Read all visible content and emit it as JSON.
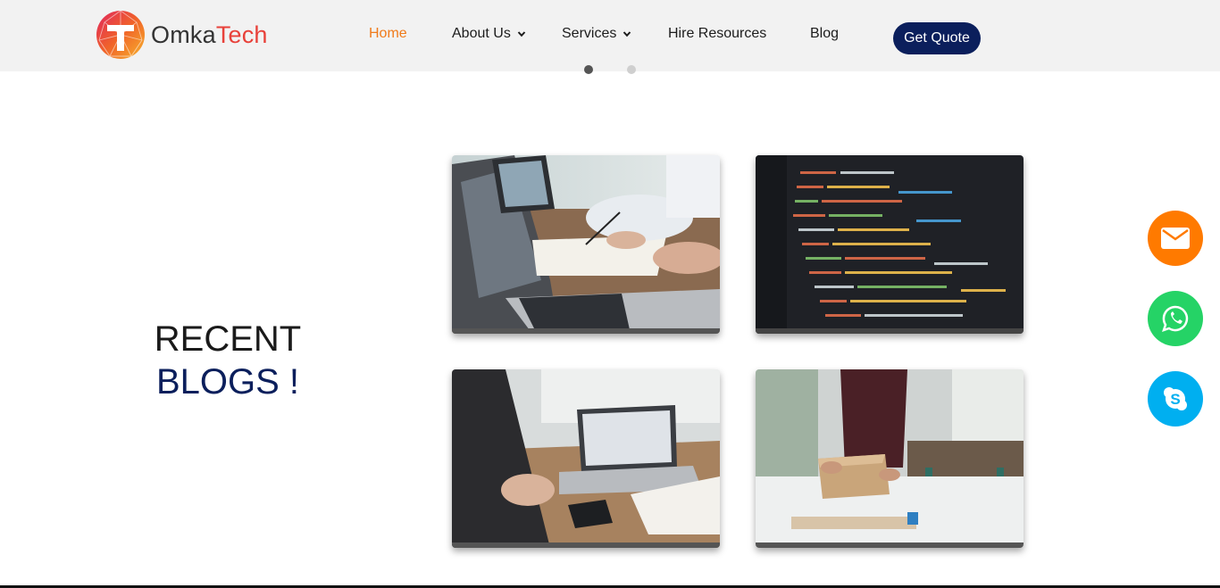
{
  "brand": {
    "name_part1": "Omka",
    "name_part2": "Tech"
  },
  "nav": {
    "items": [
      {
        "label": "Home",
        "active": true,
        "has_dropdown": false
      },
      {
        "label": "About Us",
        "active": false,
        "has_dropdown": true
      },
      {
        "label": "Services",
        "active": false,
        "has_dropdown": true
      },
      {
        "label": "Hire Resources",
        "active": false,
        "has_dropdown": false
      },
      {
        "label": "Blog",
        "active": false,
        "has_dropdown": false
      }
    ],
    "cta_label": "Get Quote"
  },
  "carousel": {
    "dot_count": 2,
    "active_index": 0
  },
  "section": {
    "title_line1": "RECENT",
    "title_line2": "BLOGS !"
  },
  "blogs": [
    {
      "image": "laptop-meeting-photo"
    },
    {
      "image": "code-screen-photo"
    },
    {
      "image": "desk-laptop-phone-photo"
    },
    {
      "image": "packing-box-photo"
    }
  ],
  "floating_actions": [
    {
      "icon": "mail-icon",
      "color": "#ff7a00"
    },
    {
      "icon": "whatsapp-icon",
      "color": "#25d366"
    },
    {
      "icon": "skype-icon",
      "color": "#00aff0"
    }
  ],
  "colors": {
    "accent": "#f07b1a",
    "brand_navy": "#0b1f5c",
    "navbar_bg": "#f2f2f2"
  }
}
